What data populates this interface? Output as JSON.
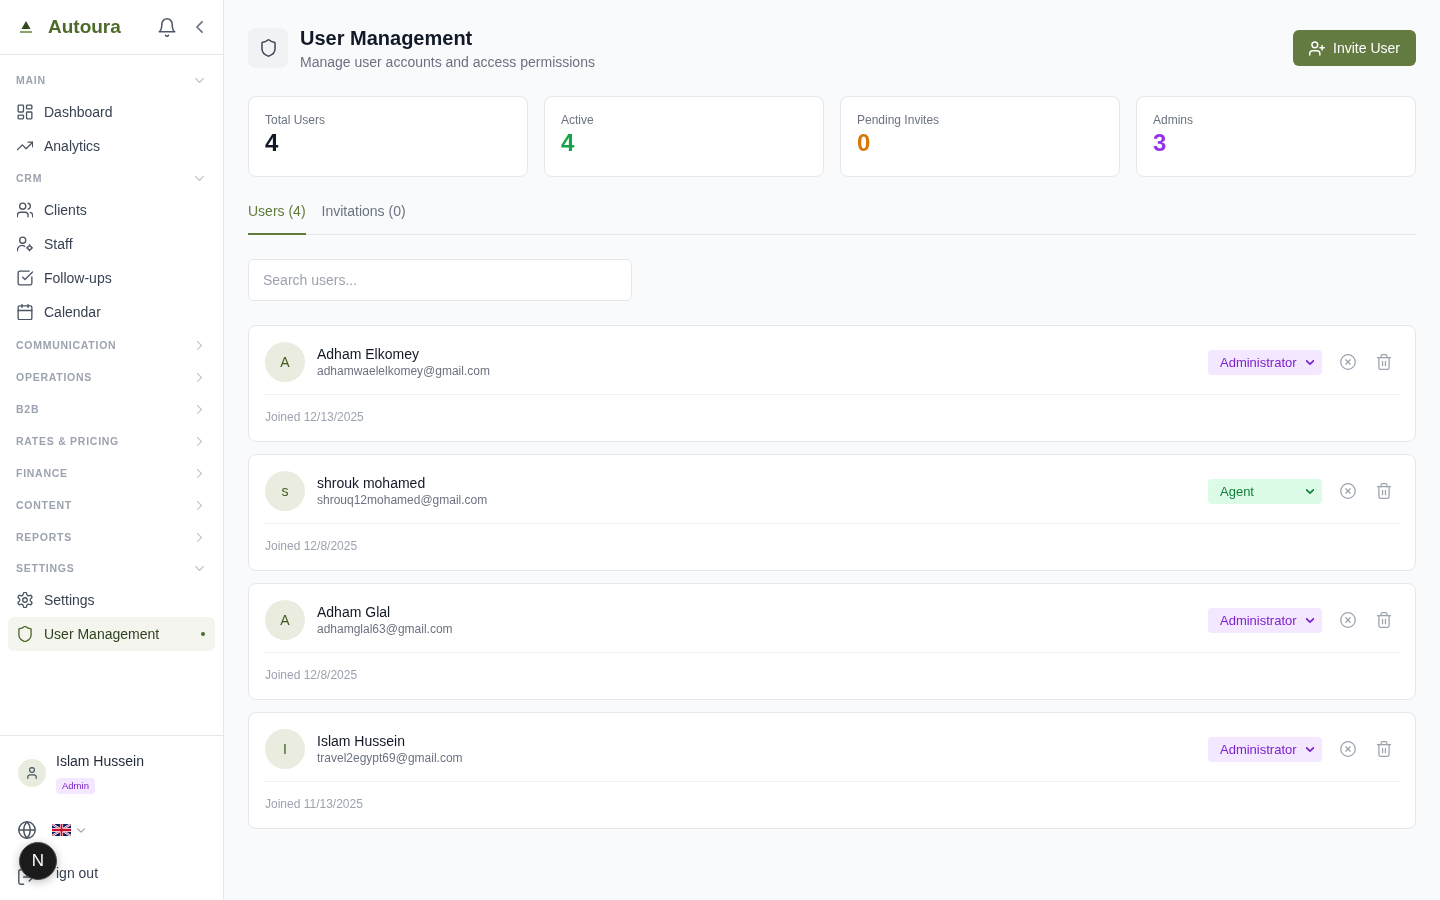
{
  "sidebar": {
    "brand": "Autoura",
    "sections": [
      {
        "label": "MAIN",
        "expanded": true,
        "items": [
          {
            "label": "Dashboard",
            "selected": false
          },
          {
            "label": "Analytics",
            "selected": false
          }
        ]
      },
      {
        "label": "CRM",
        "expanded": true,
        "items": [
          {
            "label": "Clients",
            "selected": false
          },
          {
            "label": "Staff",
            "selected": false
          },
          {
            "label": "Follow-ups",
            "selected": false
          },
          {
            "label": "Calendar",
            "selected": false
          }
        ]
      },
      {
        "label": "COMMUNICATION",
        "expanded": false
      },
      {
        "label": "OPERATIONS",
        "expanded": false
      },
      {
        "label": "B2B",
        "expanded": false
      },
      {
        "label": "RATES & PRICING",
        "expanded": false
      },
      {
        "label": "FINANCE",
        "expanded": false
      },
      {
        "label": "CONTENT",
        "expanded": false
      },
      {
        "label": "REPORTS",
        "expanded": false
      },
      {
        "label": "SETTINGS",
        "expanded": true,
        "items": [
          {
            "label": "Settings",
            "selected": false
          },
          {
            "label": "User Management",
            "selected": true
          }
        ]
      }
    ],
    "user": {
      "name": "Islam Hussein",
      "role_badge": "Admin"
    },
    "sign_out": "ign out",
    "dev_indicator": "N"
  },
  "header": {
    "title": "User Management",
    "subtitle": "Manage user accounts and access permissions",
    "invite_button": "Invite User"
  },
  "stats": [
    {
      "label": "Total Users",
      "value": "4",
      "color": "#111827"
    },
    {
      "label": "Active",
      "value": "4",
      "color": "#16a34a"
    },
    {
      "label": "Pending Invites",
      "value": "0",
      "color": "#d97706"
    },
    {
      "label": "Admins",
      "value": "3",
      "color": "#9333ea"
    }
  ],
  "tabs": [
    {
      "label": "Users (4)",
      "selected": true
    },
    {
      "label": "Invitations (0)",
      "selected": false
    }
  ],
  "search": {
    "placeholder": "Search users..."
  },
  "users": [
    {
      "initial": "A",
      "name": "Adham Elkomey",
      "email": "adhamwaelelkomey@gmail.com",
      "role": {
        "label": "Administrator",
        "kind": "admin"
      },
      "joined": "Joined 12/13/2025"
    },
    {
      "initial": "s",
      "name": "shrouk mohamed",
      "email": "shrouq12mohamed@gmail.com",
      "role": {
        "label": "Agent",
        "kind": "agent"
      },
      "joined": "Joined 12/8/2025"
    },
    {
      "initial": "A",
      "name": "Adham Glal",
      "email": "adhamglal63@gmail.com",
      "role": {
        "label": "Administrator",
        "kind": "admin"
      },
      "joined": "Joined 12/8/2025"
    },
    {
      "initial": "I",
      "name": "Islam Hussein",
      "email": "travel2egypt69@gmail.com",
      "role": {
        "label": "Administrator",
        "kind": "admin"
      },
      "joined": "Joined 11/13/2025"
    }
  ]
}
